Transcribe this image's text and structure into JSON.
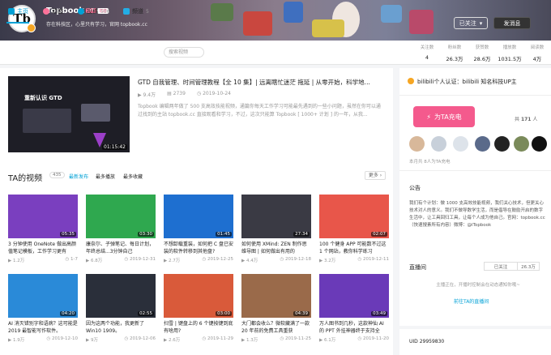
{
  "header": {
    "username": "Topbook",
    "level": "LV6",
    "vip": "年度",
    "sign": "存在科技区，心里只有学习，官网 topbook.cc",
    "follow_label": "已关注",
    "follow_icon": "chevron-down",
    "message_label": "发消息",
    "avatar_text": "Tb"
  },
  "nav": {
    "tabs": [
      {
        "label": "主页",
        "count": ""
      },
      {
        "label": "动态",
        "count": ""
      },
      {
        "label": "投稿",
        "count": "506"
      },
      {
        "label": "频道",
        "count": "5"
      }
    ],
    "search_placeholder": "搜索视频"
  },
  "stats": [
    {
      "label": "关注数",
      "value": "4"
    },
    {
      "label": "粉丝数",
      "value": "26.3万"
    },
    {
      "label": "获赞数",
      "value": "28.6万"
    },
    {
      "label": "播放数",
      "value": "1031.5万"
    },
    {
      "label": "阅读数",
      "value": "4万"
    }
  ],
  "featured": {
    "title": "GTD 自我管理、时间管理教程【全 10 集】| 远离瞎忙迷茫 拖延 | 从零开始，科学地...",
    "thumb_text": "重新认识 GTD",
    "duration": "01:15:42",
    "plays": "9.4万",
    "danmaku": "2739",
    "date": "2019-10-24",
    "desc": "Topbook 编辑两年做了 500 支高效技能视频，通篇你每天工作学习可能最先遇到的一些小问题，虽然在你可以通过找到的主站 topbook.cc 直接观看和学习，不过，这次只能算 Topbook [ 1000+ 计划 ] 的一年，从我..."
  },
  "videos": {
    "title": "TA的视频",
    "count": "435",
    "sorts": [
      "最新发布",
      "最多播放",
      "最多收藏"
    ],
    "more": "更多",
    "items": [
      {
        "title": "3 分钟使用 OneNote 做出高颜值笔记模板，工作学习更有",
        "duration": "05:35",
        "plays": "1.2万",
        "date": "1-7"
      },
      {
        "title": "康奈尔、子弹笔记、每日计划，年终总结...3分钟自己",
        "duration": "03:30",
        "plays": "6.8万",
        "date": "2019-12-31"
      },
      {
        "title": "不想卸载重装，如何把 C 盘已安装的软件转移到其他盘?",
        "duration": "01:45",
        "plays": "2.7万",
        "date": "2019-12-25"
      },
      {
        "title": "如何使用 XMind: ZEN 制作思维导图 | 如何做出有用的",
        "duration": "27:34",
        "plays": "4.4万",
        "date": "2019-12-18"
      },
      {
        "title": "100 个健身 APP 可能数不过这 1 个网站，教你科学练习",
        "duration": "02:07",
        "plays": "3.2万",
        "date": "2019-12-11"
      },
      {
        "title": "AI 消灭错别字和语病？这可能是 2019 最智能写作软件。",
        "duration": "04:20",
        "plays": "1.9万",
        "date": "2019-12-10"
      },
      {
        "title": "因为这两个功能，我更新了 Win10 1909。",
        "duration": "02:55",
        "plays": "9万",
        "date": "2019-12-06"
      },
      {
        "title": "扫雪 | 键盘上的 6 个键按键到底有啥用?",
        "duration": "03:00",
        "plays": "2.6万",
        "date": "2019-11-29"
      },
      {
        "title": "大门都会收么？微软藏满了一款 20 年前的免费工具重获",
        "duration": "04:39",
        "plays": "1.3万",
        "date": "2019-11-25"
      },
      {
        "title": "万人图书到几秒，这款神仙 AI 的 PPT 外挂神器终于支持全",
        "duration": "03:49",
        "plays": "6.1万",
        "date": "2019-11-20"
      }
    ]
  },
  "sidebar": {
    "identity": "bilibili个人认证：bilibili 知名科技UP主",
    "charge_label": "为TA充电",
    "charge_count_prefix": "共",
    "charge_count": "171",
    "charge_count_suffix": "人",
    "fans_text": "本月共 8人为TA充电",
    "announce_title": "公告",
    "announce_text": "我们有个计划：做 1000 支高效技能视频，我们关心技术，但更关心技术对人的意义。我们不做导数学生活，而是倡导在鼓励开启的数字生活中，让工具回归工具，让每个人成为他自己。官网：topbook.cc（快速搜素所有内容）微博：@iTopbook",
    "live_title": "直播间",
    "live_tags": [
      "已关注",
      "26.3万"
    ],
    "live_empty": "主播正在，开播时控制会在动态通知你哦~",
    "live_link": "前往TA的直播间",
    "uid_label": "UID",
    "uid": "29959830"
  },
  "colors": {
    "accent": "#00a1d6",
    "pink": "#fb7299",
    "charge": "#f45a8d"
  }
}
